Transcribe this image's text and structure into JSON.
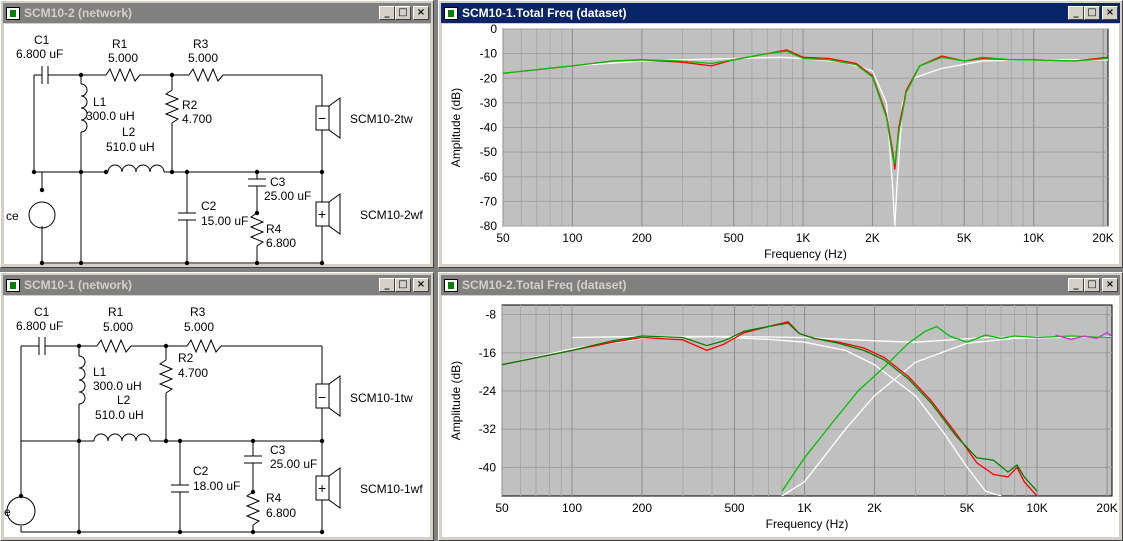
{
  "windows": {
    "net2": {
      "title": "SCM10-2 (network)",
      "components": {
        "c1": {
          "name": "C1",
          "value": "6.800 uF"
        },
        "r1": {
          "name": "R1",
          "value": "5.000"
        },
        "r3": {
          "name": "R3",
          "value": "5.000"
        },
        "l1": {
          "name": "L1",
          "value": "300.0 uH"
        },
        "r2": {
          "name": "R2",
          "value": "4.700"
        },
        "l2": {
          "name": "L2",
          "value": "510.0 uH"
        },
        "c2": {
          "name": "C2",
          "value": "15.00 uF"
        },
        "c3": {
          "name": "C3",
          "value": "25.00 uF"
        },
        "r4": {
          "name": "R4",
          "value": "6.800"
        },
        "tw": {
          "name": "SCM10-2tw",
          "sign": "−"
        },
        "wf": {
          "name": "SCM10-2wf",
          "sign": "+"
        },
        "source": "ce"
      }
    },
    "net1": {
      "title": "SCM10-1 (network)",
      "components": {
        "c1": {
          "name": "C1",
          "value": "6.800 uF"
        },
        "r1": {
          "name": "R1",
          "value": "5.000"
        },
        "r3": {
          "name": "R3",
          "value": "5.000"
        },
        "l1": {
          "name": "L1",
          "value": "300.0 uH"
        },
        "r2": {
          "name": "R2",
          "value": "4.700"
        },
        "l2": {
          "name": "L2",
          "value": "510.0 uH"
        },
        "c2": {
          "name": "C2",
          "value": "18.00 uF"
        },
        "c3": {
          "name": "C3",
          "value": "25.00 uF"
        },
        "r4": {
          "name": "R4",
          "value": "6.800"
        },
        "tw": {
          "name": "SCM10-1tw",
          "sign": "−"
        },
        "wf": {
          "name": "SCM10-1wf",
          "sign": "+"
        },
        "source": "e"
      }
    },
    "freq1": {
      "title": "SCM10-1.Total Freq (dataset)"
    },
    "freq2": {
      "title": "SCM10-2.Total Freq (dataset)"
    }
  },
  "buttons": {
    "minimize": "_",
    "maximize": "□",
    "close": "×"
  },
  "chart_data": [
    {
      "type": "line",
      "xlabel": "Frequency (Hz)",
      "ylabel": "Amplitude (dB)",
      "x_scale": "log",
      "xlim": [
        50,
        21000
      ],
      "ylim": [
        -80,
        0
      ],
      "x_ticks": [
        50,
        100,
        200,
        500,
        1000,
        2000,
        5000,
        10000,
        20000
      ],
      "x_tick_labels": [
        "50",
        "100",
        "200",
        "500",
        "1K",
        "2K",
        "5K",
        "10K",
        "20K"
      ],
      "y_ticks": [
        0,
        -10,
        -20,
        -30,
        -40,
        -50,
        -60,
        -70,
        -80
      ],
      "y_tick_labels": [
        "0",
        "-10",
        "-20",
        "-30",
        "-40",
        "-50",
        "-60",
        "-70",
        "-80"
      ],
      "grid": true,
      "background": "#c0c0c0",
      "series": [
        {
          "color": "#ffffff",
          "x": [
            50,
            100,
            200,
            300,
            500,
            800,
            1000,
            1500,
            2000,
            2300,
            2450,
            2500,
            2550,
            2700,
            3000,
            4000,
            6000,
            10000,
            21000
          ],
          "y": [
            -18,
            -15,
            -13,
            -12.5,
            -12,
            -11.5,
            -12,
            -13.5,
            -17,
            -30,
            -65,
            -80,
            -65,
            -30,
            -20,
            -16,
            -13,
            -12.5,
            -12.5
          ]
        },
        {
          "color": "#ff0000",
          "x": [
            50,
            100,
            150,
            200,
            300,
            400,
            500,
            700,
            850,
            1000,
            1300,
            1700,
            2000,
            2300,
            2450,
            2500,
            2600,
            2800,
            3200,
            4000,
            5000,
            6000,
            8000,
            10000,
            15000,
            21000
          ],
          "y": [
            -18,
            -15,
            -13,
            -12.5,
            -13.5,
            -15,
            -12.5,
            -10,
            -8.5,
            -11.5,
            -12,
            -14,
            -19,
            -35,
            -50,
            -57,
            -40,
            -25,
            -15,
            -11,
            -13,
            -12,
            -12.5,
            -12.5,
            -13,
            -11.5
          ]
        },
        {
          "color": "#00c000",
          "x": [
            50,
            100,
            150,
            200,
            300,
            400,
            500,
            700,
            850,
            1000,
            1300,
            1700,
            2000,
            2300,
            2450,
            2500,
            2600,
            2800,
            3200,
            4000,
            5000,
            6000,
            8000,
            10000,
            15000,
            21000
          ],
          "y": [
            -18,
            -15,
            -13,
            -12.5,
            -13,
            -14,
            -12.5,
            -10,
            -9,
            -12,
            -12.5,
            -14.5,
            -19.5,
            -36,
            -52,
            -55,
            -42,
            -26,
            -15,
            -11.5,
            -13,
            -11.5,
            -12.5,
            -12.5,
            -13,
            -12
          ]
        }
      ]
    },
    {
      "type": "line",
      "xlabel": "Frequency (Hz)",
      "ylabel": "Amplitude (dB)",
      "x_scale": "log",
      "xlim": [
        50,
        21000
      ],
      "ylim": [
        -46,
        -6
      ],
      "x_ticks": [
        50,
        100,
        200,
        500,
        1000,
        2000,
        5000,
        10000,
        20000
      ],
      "x_tick_labels": [
        "50",
        "100",
        "200",
        "500",
        "1K",
        "2K",
        "5K",
        "10K",
        "20K"
      ],
      "y_ticks": [
        -8,
        -16,
        -24,
        -32,
        -40
      ],
      "y_tick_labels": [
        "-8",
        "-16",
        "-24",
        "-32",
        "-40"
      ],
      "grid": true,
      "background": "#c0c0c0",
      "series": [
        {
          "color": "#ffffff",
          "x": [
            100,
            200,
            500,
            1000,
            2000,
            3000,
            6000,
            21000
          ],
          "y": [
            -12.8,
            -12.6,
            -12.6,
            -12.8,
            -13.5,
            -13.8,
            -12.8,
            -12.6
          ]
        },
        {
          "color": "#ffffff",
          "x": [
            50,
            100,
            200,
            400,
            700,
            1000,
            1500,
            2000,
            3000,
            4000,
            5000,
            6000,
            7000
          ],
          "y": [
            -18.5,
            -15.2,
            -13,
            -12.6,
            -13.2,
            -13.8,
            -15.5,
            -18.5,
            -25,
            -33,
            -40,
            -45,
            -48
          ]
        },
        {
          "color": "#ffffff",
          "x": [
            800,
            1000,
            1500,
            2000,
            3000,
            5000,
            8000,
            21000
          ],
          "y": [
            -50,
            -43,
            -32,
            -25,
            -18,
            -14,
            -13,
            -12.6
          ]
        },
        {
          "color": "#ff0000",
          "x": [
            50,
            100,
            150,
            200,
            300,
            380,
            450,
            550,
            700,
            850,
            950,
            1100,
            1400,
            1800,
            2200,
            2800,
            3500,
            4500,
            5500,
            6500,
            7500,
            8200,
            8800,
            10000
          ],
          "y": [
            -18.5,
            -15.5,
            -13.8,
            -12.8,
            -13.3,
            -15.5,
            -14.2,
            -11.8,
            -10.5,
            -9.5,
            -12,
            -13,
            -13.8,
            -15,
            -17,
            -21,
            -26,
            -33,
            -39,
            -41.5,
            -42,
            -40,
            -43,
            -46
          ]
        },
        {
          "color": "#008000",
          "x": [
            50,
            100,
            150,
            200,
            300,
            380,
            450,
            550,
            700,
            850,
            950,
            1100,
            1400,
            1800,
            2200,
            2800,
            3500,
            4500,
            5500,
            6500,
            7500,
            8200,
            8800,
            10000
          ],
          "y": [
            -18.5,
            -15.5,
            -13.5,
            -12.5,
            -12.8,
            -14.5,
            -13.5,
            -11.5,
            -10.5,
            -9.8,
            -12,
            -13,
            -14,
            -15.5,
            -17.5,
            -21.5,
            -26.5,
            -33.5,
            -38,
            -38.5,
            -41,
            -39.5,
            -42,
            -45
          ]
        },
        {
          "color": "#00c000",
          "x": [
            800,
            1000,
            1300,
            1700,
            2200,
            2800,
            3300,
            3700,
            4200,
            5000,
            6000,
            7000,
            8000,
            10000,
            14000,
            21000
          ],
          "y": [
            -45,
            -38,
            -31,
            -24,
            -19,
            -14,
            -11.5,
            -10.5,
            -12.5,
            -13.8,
            -12.3,
            -13,
            -12.5,
            -12.8,
            -12.5,
            -12.8
          ]
        },
        {
          "color": "#d030d0",
          "x": [
            12000,
            14000,
            16000,
            18000,
            20000,
            21000
          ],
          "y": [
            -12.3,
            -13.2,
            -12.5,
            -13,
            -11.8,
            -12.6
          ]
        }
      ]
    }
  ]
}
